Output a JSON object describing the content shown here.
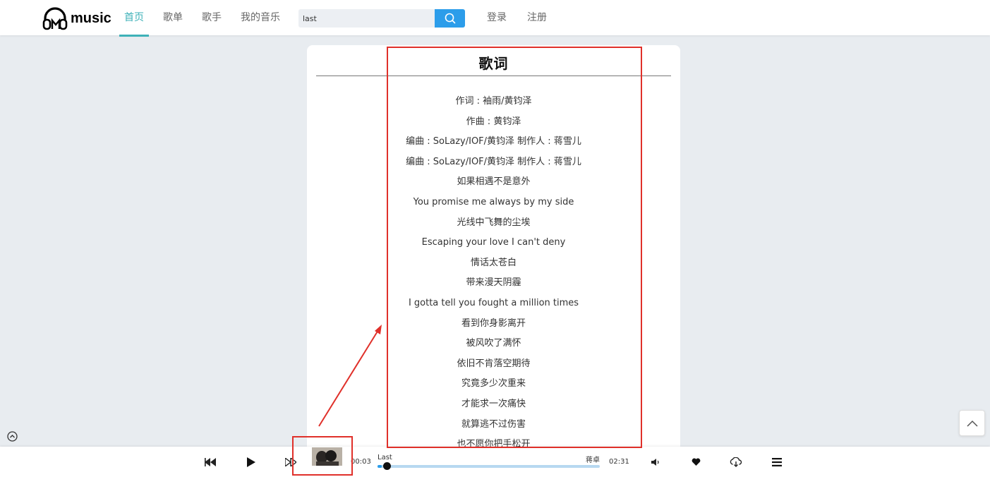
{
  "header": {
    "logo_text": "music",
    "nav": [
      "首页",
      "歌单",
      "歌手",
      "我的音乐"
    ],
    "active_nav": "首页",
    "search_value": "last",
    "auth": {
      "login": "登录",
      "register": "注册"
    }
  },
  "lyrics_panel": {
    "title": "歌词",
    "lines": [
      "作词 : 袖雨/黄钧泽",
      "作曲 : 黄钧泽",
      "编曲 : SoLazy/IOF/黄钧泽 制作人 : 蒋雪儿",
      "编曲 : SoLazy/IOF/黄钧泽 制作人 : 蒋雪儿",
      "如果相遇不是意外",
      "You promise me always by my side",
      "光线中飞舞的尘埃",
      "Escaping your love I can't deny",
      "情话太苍白",
      "带来漫天阴霾",
      "I gotta tell you fought a million times",
      "看到你身影离开",
      "被风吹了满怀",
      "依旧不肯落空期待",
      "究竟多少次重来",
      "才能求一次痛快",
      "就算逃不过伤害",
      "也不愿你把手松开"
    ]
  },
  "player": {
    "current_time": "00:03",
    "total_time": "02:31",
    "song_title": "Last",
    "artist": "蒋卓",
    "progress": 0.02
  },
  "icons": {
    "search": "search-icon",
    "prev": "rewind-icon",
    "play": "play-icon",
    "next": "fast-forward-icon",
    "volume": "volume-icon",
    "like": "heart-icon",
    "download": "cloud-download-icon",
    "playlist": "menu-icon",
    "back_to_top": "chevron-up-icon",
    "collapse": "circle-chevron-up-icon"
  },
  "colors": {
    "accent": "#3eb1b8",
    "search_button": "#2c9dea",
    "annotation": "#e0302a",
    "progress_track": "#b7d8f0"
  }
}
